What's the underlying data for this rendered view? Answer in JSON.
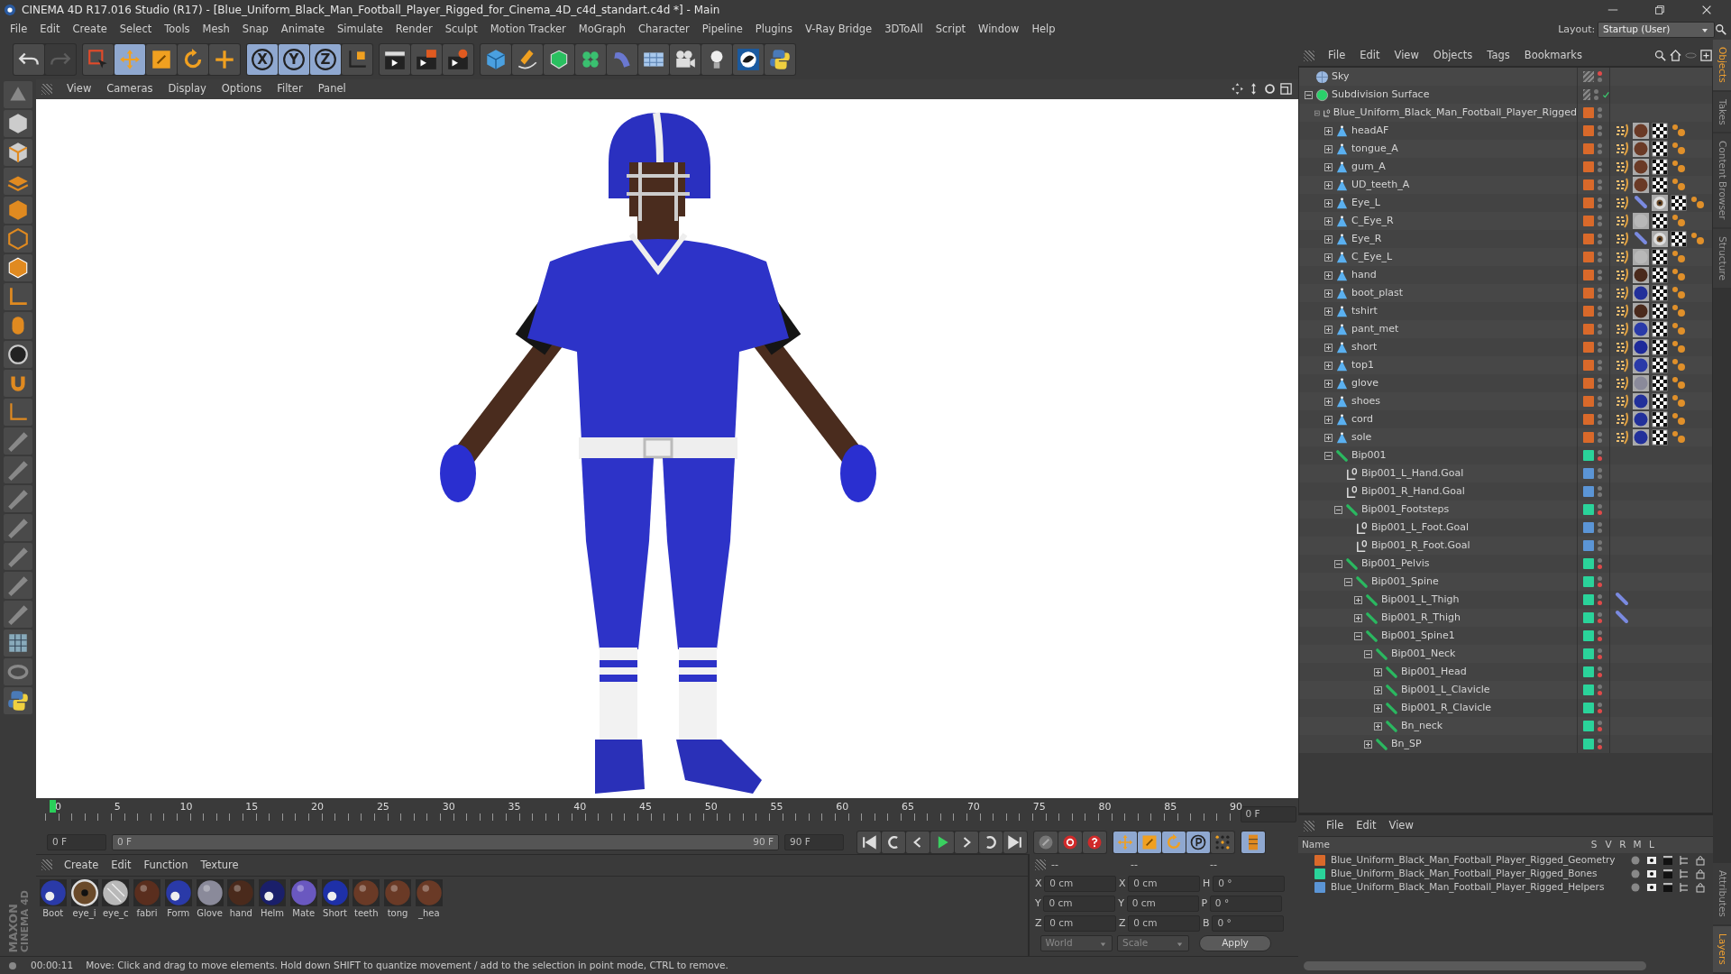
{
  "window": {
    "title": "CINEMA 4D R17.016 Studio (R17) - [Blue_Uniform_Black_Man_Football_Player_Rigged_for_Cinema_4D_c4d_standart.c4d *] - Main"
  },
  "menu": [
    "File",
    "Edit",
    "Create",
    "Select",
    "Tools",
    "Mesh",
    "Snap",
    "Animate",
    "Simulate",
    "Render",
    "Sculpt",
    "Motion Tracker",
    "MoGraph",
    "Character",
    "Pipeline",
    "Plugins",
    "V-Ray Bridge",
    "3DToAll",
    "Script",
    "Window",
    "Help"
  ],
  "layout": {
    "label": "Layout:",
    "value": "Startup (User)"
  },
  "toolbar": [
    [
      {
        "kind": "undo",
        "disabled": false
      },
      {
        "kind": "redo",
        "disabled": true
      }
    ],
    [
      {
        "kind": "live-select",
        "selected": false
      },
      {
        "kind": "move",
        "selected": true
      },
      {
        "kind": "scale",
        "selected": false
      },
      {
        "kind": "rotate",
        "selected": false
      },
      {
        "kind": "last-tool",
        "selected": false
      }
    ],
    [
      {
        "kind": "axis",
        "label": "X",
        "selected": true
      },
      {
        "kind": "axis",
        "label": "Y",
        "selected": true
      },
      {
        "kind": "axis",
        "label": "Z",
        "selected": true
      },
      {
        "kind": "coord-system",
        "selected": false
      }
    ],
    [
      {
        "kind": "render-view"
      },
      {
        "kind": "render-picture"
      },
      {
        "kind": "render-settings"
      }
    ],
    [
      {
        "kind": "cube"
      },
      {
        "kind": "pen"
      },
      {
        "kind": "subdivision"
      },
      {
        "kind": "cloner"
      },
      {
        "kind": "deformer"
      },
      {
        "kind": "floor"
      },
      {
        "kind": "camera"
      },
      {
        "kind": "light"
      },
      {
        "kind": "sculpt-logo"
      },
      {
        "kind": "python"
      }
    ]
  ],
  "viewport": {
    "menu": [
      "View",
      "Cameras",
      "Display",
      "Options",
      "Filter",
      "Panel"
    ]
  },
  "objects": {
    "menu": [
      "File",
      "Edit",
      "View",
      "Objects",
      "Tags",
      "Bookmarks"
    ],
    "tree": [
      {
        "name": "Sky",
        "kind": "sky",
        "editor_off": true,
        "render_off": false
      },
      {
        "name": "Subdivision Surface",
        "kind": "subdivision",
        "expanded": true,
        "enabled": true,
        "editor_off": false,
        "render_off": false,
        "children": [
          {
            "name": "Blue_Uniform_Black_Man_Football_Player_Rigged",
            "kind": "null",
            "color": "#d9692a",
            "expanded": true,
            "editor_off": false,
            "render_off": false,
            "children": [
              {
                "name": "headAF",
                "kind": "polygon",
                "color": "#d9692a",
                "expanded": false,
                "editor_off": false,
                "render_off": false,
                "tags": [
                  {
                    "kind": "phong"
                  },
                  {
                    "kind": "material",
                    "color": "#6a3a26"
                  },
                  {
                    "kind": "uvw"
                  },
                  {
                    "kind": "weight"
                  }
                ]
              },
              {
                "name": "tongue_A",
                "kind": "polygon",
                "color": "#d9692a",
                "expanded": false,
                "editor_off": false,
                "render_off": false,
                "tags": [
                  {
                    "kind": "phong"
                  },
                  {
                    "kind": "material",
                    "color": "#6a3a26"
                  },
                  {
                    "kind": "uvw"
                  },
                  {
                    "kind": "weight"
                  }
                ]
              },
              {
                "name": "gum_A",
                "kind": "polygon",
                "color": "#d9692a",
                "expanded": false,
                "editor_off": false,
                "render_off": false,
                "tags": [
                  {
                    "kind": "phong"
                  },
                  {
                    "kind": "material",
                    "color": "#6a3a26"
                  },
                  {
                    "kind": "uvw"
                  },
                  {
                    "kind": "weight"
                  }
                ]
              },
              {
                "name": "UD_teeth_A",
                "kind": "polygon",
                "color": "#d9692a",
                "expanded": false,
                "editor_off": false,
                "render_off": false,
                "tags": [
                  {
                    "kind": "phong"
                  },
                  {
                    "kind": "material",
                    "color": "#6a3a26"
                  },
                  {
                    "kind": "uvw"
                  },
                  {
                    "kind": "weight"
                  }
                ]
              },
              {
                "name": "Eye_L",
                "kind": "polygon",
                "color": "#d9692a",
                "expanded": false,
                "editor_off": false,
                "render_off": false,
                "tags": [
                  {
                    "kind": "phong"
                  },
                  {
                    "kind": "ik"
                  },
                  {
                    "kind": "eye-material"
                  },
                  {
                    "kind": "uvw"
                  },
                  {
                    "kind": "weight"
                  }
                ]
              },
              {
                "name": "C_Eye_R",
                "kind": "polygon",
                "color": "#d9692a",
                "expanded": false,
                "editor_off": false,
                "render_off": false,
                "tags": [
                  {
                    "kind": "phong"
                  },
                  {
                    "kind": "material",
                    "color": "#b8b8b8"
                  },
                  {
                    "kind": "uvw"
                  },
                  {
                    "kind": "weight"
                  }
                ]
              },
              {
                "name": "Eye_R",
                "kind": "polygon",
                "color": "#d9692a",
                "expanded": false,
                "editor_off": false,
                "render_off": false,
                "tags": [
                  {
                    "kind": "phong"
                  },
                  {
                    "kind": "ik"
                  },
                  {
                    "kind": "eye-material"
                  },
                  {
                    "kind": "uvw"
                  },
                  {
                    "kind": "weight"
                  }
                ]
              },
              {
                "name": "C_Eye_L",
                "kind": "polygon",
                "color": "#d9692a",
                "expanded": false,
                "editor_off": false,
                "render_off": false,
                "tags": [
                  {
                    "kind": "phong"
                  },
                  {
                    "kind": "material",
                    "color": "#b8b8b8"
                  },
                  {
                    "kind": "uvw"
                  },
                  {
                    "kind": "weight"
                  }
                ]
              },
              {
                "name": "hand",
                "kind": "polygon",
                "color": "#d9692a",
                "expanded": false,
                "editor_off": false,
                "render_off": false,
                "tags": [
                  {
                    "kind": "phong"
                  },
                  {
                    "kind": "material",
                    "color": "#4a2a1c"
                  },
                  {
                    "kind": "uvw"
                  },
                  {
                    "kind": "weight"
                  }
                ]
              },
              {
                "name": "boot_plast",
                "kind": "polygon",
                "color": "#d9692a",
                "expanded": false,
                "editor_off": false,
                "render_off": false,
                "tags": [
                  {
                    "kind": "phong"
                  },
                  {
                    "kind": "material",
                    "color": "#22309a"
                  },
                  {
                    "kind": "uvw"
                  },
                  {
                    "kind": "weight"
                  }
                ]
              },
              {
                "name": "tshirt",
                "kind": "polygon",
                "color": "#d9692a",
                "expanded": false,
                "editor_off": false,
                "render_off": false,
                "tags": [
                  {
                    "kind": "phong"
                  },
                  {
                    "kind": "material",
                    "color": "#4a2a1c"
                  },
                  {
                    "kind": "uvw"
                  },
                  {
                    "kind": "weight"
                  }
                ]
              },
              {
                "name": "pant_met",
                "kind": "polygon",
                "color": "#d9692a",
                "expanded": false,
                "editor_off": false,
                "render_off": false,
                "tags": [
                  {
                    "kind": "phong"
                  },
                  {
                    "kind": "material",
                    "color": "#2a3aa8"
                  },
                  {
                    "kind": "uvw"
                  },
                  {
                    "kind": "weight"
                  }
                ]
              },
              {
                "name": "short",
                "kind": "polygon",
                "color": "#d9692a",
                "expanded": false,
                "editor_off": false,
                "render_off": false,
                "tags": [
                  {
                    "kind": "phong"
                  },
                  {
                    "kind": "material",
                    "color": "#1e2a9a"
                  },
                  {
                    "kind": "uvw"
                  },
                  {
                    "kind": "weight"
                  }
                ]
              },
              {
                "name": "top1",
                "kind": "polygon",
                "color": "#d9692a",
                "expanded": false,
                "editor_off": false,
                "render_off": false,
                "tags": [
                  {
                    "kind": "phong"
                  },
                  {
                    "kind": "material",
                    "color": "#2a3aa8"
                  },
                  {
                    "kind": "uvw"
                  },
                  {
                    "kind": "weight"
                  }
                ]
              },
              {
                "name": "glove",
                "kind": "polygon",
                "color": "#d9692a",
                "expanded": false,
                "editor_off": false,
                "render_off": false,
                "tags": [
                  {
                    "kind": "phong"
                  },
                  {
                    "kind": "material",
                    "color": "#8a8a9a"
                  },
                  {
                    "kind": "uvw"
                  },
                  {
                    "kind": "weight"
                  }
                ]
              },
              {
                "name": "shoes",
                "kind": "polygon",
                "color": "#d9692a",
                "expanded": false,
                "editor_off": false,
                "render_off": false,
                "tags": [
                  {
                    "kind": "phong"
                  },
                  {
                    "kind": "material",
                    "color": "#22309a"
                  },
                  {
                    "kind": "uvw"
                  },
                  {
                    "kind": "weight"
                  }
                ]
              },
              {
                "name": "cord",
                "kind": "polygon",
                "color": "#d9692a",
                "expanded": false,
                "editor_off": false,
                "render_off": false,
                "tags": [
                  {
                    "kind": "phong"
                  },
                  {
                    "kind": "material",
                    "color": "#22309a"
                  },
                  {
                    "kind": "uvw"
                  },
                  {
                    "kind": "weight"
                  }
                ]
              },
              {
                "name": "sole",
                "kind": "polygon",
                "color": "#d9692a",
                "expanded": false,
                "editor_off": false,
                "render_off": false,
                "tags": [
                  {
                    "kind": "phong"
                  },
                  {
                    "kind": "material",
                    "color": "#22309a"
                  },
                  {
                    "kind": "uvw"
                  },
                  {
                    "kind": "weight"
                  }
                ]
              },
              {
                "name": "Bip001",
                "kind": "bone",
                "color": "#2ad39a",
                "expanded": true,
                "editor_off": false,
                "render_off": true,
                "children": [
                  {
                    "name": "Bip001_L_Hand.Goal",
                    "kind": "null",
                    "color": "#5b95d6",
                    "editor_off": false,
                    "render_off": false
                  },
                  {
                    "name": "Bip001_R_Hand.Goal",
                    "kind": "null",
                    "color": "#5b95d6",
                    "editor_off": false,
                    "render_off": false
                  },
                  {
                    "name": "Bip001_Footsteps",
                    "kind": "bone",
                    "color": "#2ad39a",
                    "expanded": true,
                    "editor_off": false,
                    "render_off": true,
                    "children": [
                      {
                        "name": "Bip001_L_Foot.Goal",
                        "kind": "null",
                        "color": "#5b95d6",
                        "editor_off": false,
                        "render_off": false
                      },
                      {
                        "name": "Bip001_R_Foot.Goal",
                        "kind": "null",
                        "color": "#5b95d6",
                        "editor_off": false,
                        "render_off": false
                      }
                    ]
                  },
                  {
                    "name": "Bip001_Pelvis",
                    "kind": "bone",
                    "color": "#2ad39a",
                    "expanded": true,
                    "editor_off": false,
                    "render_off": true,
                    "children": [
                      {
                        "name": "Bip001_Spine",
                        "kind": "bone",
                        "color": "#2ad39a",
                        "expanded": true,
                        "editor_off": false,
                        "render_off": true,
                        "children": [
                          {
                            "name": "Bip001_L_Thigh",
                            "kind": "bone",
                            "color": "#2ad39a",
                            "expanded": false,
                            "editor_off": false,
                            "render_off": true,
                            "tags": [
                              {
                                "kind": "ik"
                              }
                            ]
                          },
                          {
                            "name": "Bip001_R_Thigh",
                            "kind": "bone",
                            "color": "#2ad39a",
                            "expanded": false,
                            "editor_off": false,
                            "render_off": true,
                            "tags": [
                              {
                                "kind": "ik"
                              }
                            ]
                          },
                          {
                            "name": "Bip001_Spine1",
                            "kind": "bone",
                            "color": "#2ad39a",
                            "expanded": true,
                            "editor_off": false,
                            "render_off": true,
                            "children": [
                              {
                                "name": "Bip001_Neck",
                                "kind": "bone",
                                "color": "#2ad39a",
                                "expanded": true,
                                "editor_off": false,
                                "render_off": true,
                                "children": [
                                  {
                                    "name": "Bip001_Head",
                                    "kind": "bone",
                                    "color": "#2ad39a",
                                    "expanded": false,
                                    "editor_off": false,
                                    "render_off": true
                                  },
                                  {
                                    "name": "Bip001_L_Clavicle",
                                    "kind": "bone",
                                    "color": "#2ad39a",
                                    "expanded": false,
                                    "editor_off": false,
                                    "render_off": true
                                  },
                                  {
                                    "name": "Bip001_R_Clavicle",
                                    "kind": "bone",
                                    "color": "#2ad39a",
                                    "expanded": false,
                                    "editor_off": false,
                                    "render_off": true
                                  },
                                  {
                                    "name": "Bn_neck",
                                    "kind": "bone",
                                    "color": "#2ad39a",
                                    "expanded": false,
                                    "editor_off": false,
                                    "render_off": true
                                  }
                                ]
                              },
                              {
                                "name": "Bn_SP",
                                "kind": "bone",
                                "color": "#2ad39a",
                                "expanded": false,
                                "editor_off": false,
                                "render_off": true
                              }
                            ]
                          }
                        ]
                      }
                    ]
                  }
                ]
              }
            ]
          }
        ]
      }
    ]
  },
  "timeline": {
    "ticks": [
      "0",
      "5",
      "10",
      "15",
      "20",
      "25",
      "30",
      "35",
      "40",
      "45",
      "50",
      "55",
      "60",
      "65",
      "70",
      "75",
      "80",
      "85",
      "90"
    ],
    "level": 0,
    "current": "0 F"
  },
  "playback": {
    "start": "0 F",
    "range_start": "0 F",
    "range_end": "90 F",
    "end": "90 F",
    "groups": [
      [
        {
          "kind": "first"
        },
        {
          "kind": "prev-key"
        },
        {
          "kind": "prev-frame"
        },
        {
          "kind": "play"
        },
        {
          "kind": "next-frame"
        },
        {
          "kind": "next-key"
        },
        {
          "kind": "last"
        }
      ],
      [
        {
          "kind": "keyframe-off",
          "selected": false
        },
        {
          "kind": "record",
          "selected": false
        },
        {
          "kind": "auto-key",
          "selected": false
        }
      ],
      [
        {
          "kind": "move",
          "selected": true
        },
        {
          "kind": "scale",
          "selected": true
        },
        {
          "kind": "rotate",
          "selected": true
        },
        {
          "kind": "param",
          "selected": true
        },
        {
          "kind": "points",
          "selected": false
        }
      ],
      [
        {
          "kind": "film",
          "selected": true
        }
      ]
    ]
  },
  "materials": {
    "menu": [
      "Create",
      "Edit",
      "Function",
      "Texture"
    ],
    "items": [
      {
        "name": "Boot",
        "kind": "shiny",
        "color": "#2a3aa8"
      },
      {
        "name": "eye_i",
        "kind": "eye",
        "color": "#6a4a2a"
      },
      {
        "name": "eye_c",
        "kind": "glass",
        "color": "#b8b8b8"
      },
      {
        "name": "fabri",
        "kind": "matte",
        "color": "#5a2e1e"
      },
      {
        "name": "Form",
        "kind": "shiny",
        "color": "#2a3aa8"
      },
      {
        "name": "Glove",
        "kind": "matte",
        "color": "#8a8a9a"
      },
      {
        "name": "hand",
        "kind": "matte",
        "color": "#4a2a1c"
      },
      {
        "name": "Helm",
        "kind": "shiny",
        "color": "#1a1f6a"
      },
      {
        "name": "Mate",
        "kind": "matte",
        "color": "#6a58c0"
      },
      {
        "name": "Short",
        "kind": "shiny",
        "color": "#1e30a8"
      },
      {
        "name": "teeth",
        "kind": "matte",
        "color": "#6a3a26"
      },
      {
        "name": "tong",
        "kind": "matte",
        "color": "#6a3a26"
      },
      {
        "name": "_hea",
        "kind": "matte",
        "color": "#6a3a26"
      }
    ]
  },
  "coordinates": {
    "headers": [
      "--",
      "--",
      "--"
    ],
    "rows": [
      {
        "axis": "X",
        "position": "0 cm",
        "size_axis": "X",
        "size": "0 cm",
        "rot_axis": "H",
        "rotation": "0 °"
      },
      {
        "axis": "Y",
        "position": "0 cm",
        "size_axis": "Y",
        "size": "0 cm",
        "rot_axis": "P",
        "rotation": "0 °"
      },
      {
        "axis": "Z",
        "position": "0 cm",
        "size_axis": "Z",
        "size": "0 cm",
        "rot_axis": "B",
        "rotation": "0 °"
      }
    ],
    "mode": "World",
    "size_mode": "Scale",
    "apply": "Apply"
  },
  "brand": [
    "MAXON",
    "CINEMA 4D"
  ],
  "status": {
    "time": "00:00:11",
    "message": "Move: Click and drag to move elements. Hold down SHIFT to quantize movement / add to the selection in point mode, CTRL to remove."
  },
  "layers": {
    "menu": [
      "File",
      "Edit",
      "View"
    ],
    "columns": [
      "Name",
      "S",
      "V",
      "R",
      "M",
      "L"
    ],
    "rows": [
      {
        "name": "Blue_Uniform_Black_Man_Football_Player_Rigged_Geometry",
        "color": "#d9692a"
      },
      {
        "name": "Blue_Uniform_Black_Man_Football_Player_Rigged_Bones",
        "color": "#2ad39a"
      },
      {
        "name": "Blue_Uniform_Black_Man_Football_Player_Rigged_Helpers",
        "color": "#5b95d6"
      }
    ]
  },
  "side_tabs": [
    {
      "label": "Objects",
      "selected": true
    },
    {
      "label": "Takes",
      "selected": false
    },
    {
      "label": "Content Browser",
      "selected": false
    },
    {
      "label": "Structure",
      "selected": false
    }
  ],
  "bottom_tabs": [
    {
      "label": "Attributes",
      "selected": false
    },
    {
      "label": "Layers",
      "selected": true
    }
  ]
}
